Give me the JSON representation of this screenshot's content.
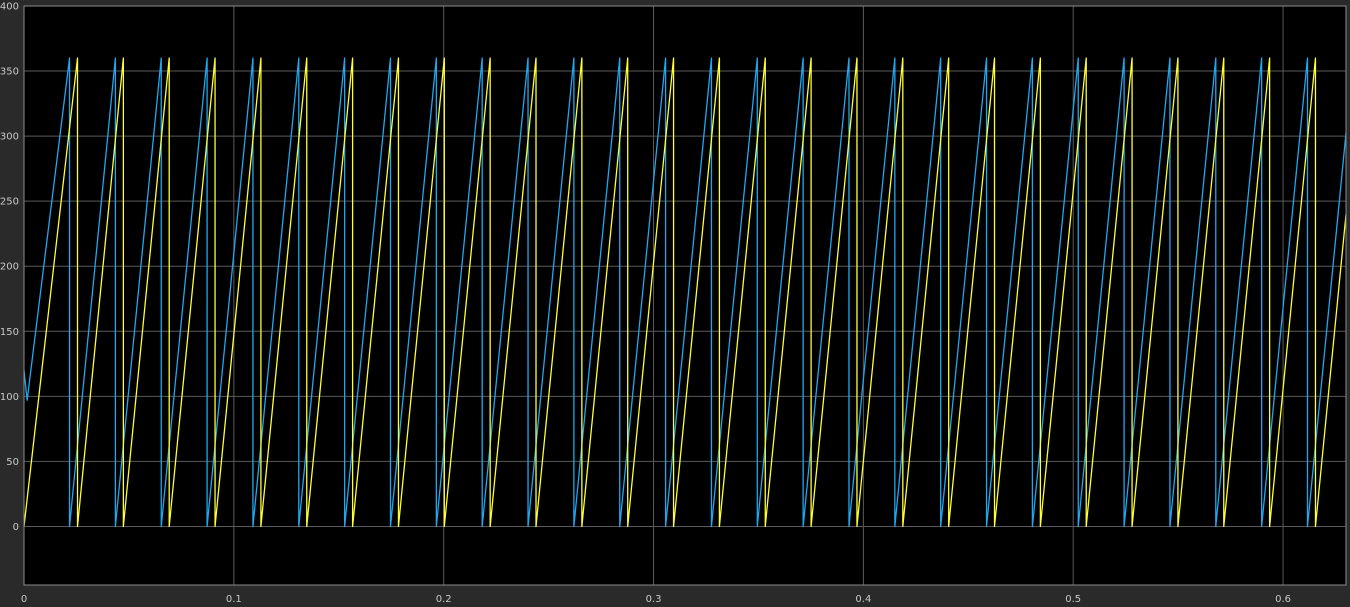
{
  "chart_data": {
    "type": "line",
    "title": "",
    "xlabel": "",
    "ylabel": "",
    "xlim": [
      0,
      0.63
    ],
    "ylim": [
      -45,
      400
    ],
    "grid": true,
    "background_color": "#000000",
    "figure_color": "#2a2a2a",
    "grid_color": "#5a5a5a",
    "tick_label_color": "#c8c8c8",
    "x_ticks": [
      0,
      0.1,
      0.2,
      0.3,
      0.4,
      0.5,
      0.6
    ],
    "x_tick_labels": [
      "0",
      "0.1",
      "0.2",
      "0.3",
      "0.4",
      "0.5",
      "0.6"
    ],
    "y_ticks": [
      0,
      50,
      100,
      150,
      200,
      250,
      300,
      350,
      400
    ],
    "y_tick_labels": [
      "0",
      "50",
      "100",
      "150",
      "200",
      "250",
      "300",
      "350",
      "400"
    ],
    "series": [
      {
        "color": "#1fa8f0",
        "waveform": "sawtooth",
        "min": 0,
        "max": 360,
        "initial_value": 120,
        "initial_dip": 97,
        "first_peak_time": 0.0217,
        "period": 0.02185,
        "end_time": 0.63
      },
      {
        "color": "#ffff33",
        "waveform": "sawtooth",
        "min": 0,
        "max": 360,
        "initial_value": 0,
        "first_peak_time": 0.0255,
        "period": 0.02185,
        "end_time": 0.63
      }
    ]
  }
}
